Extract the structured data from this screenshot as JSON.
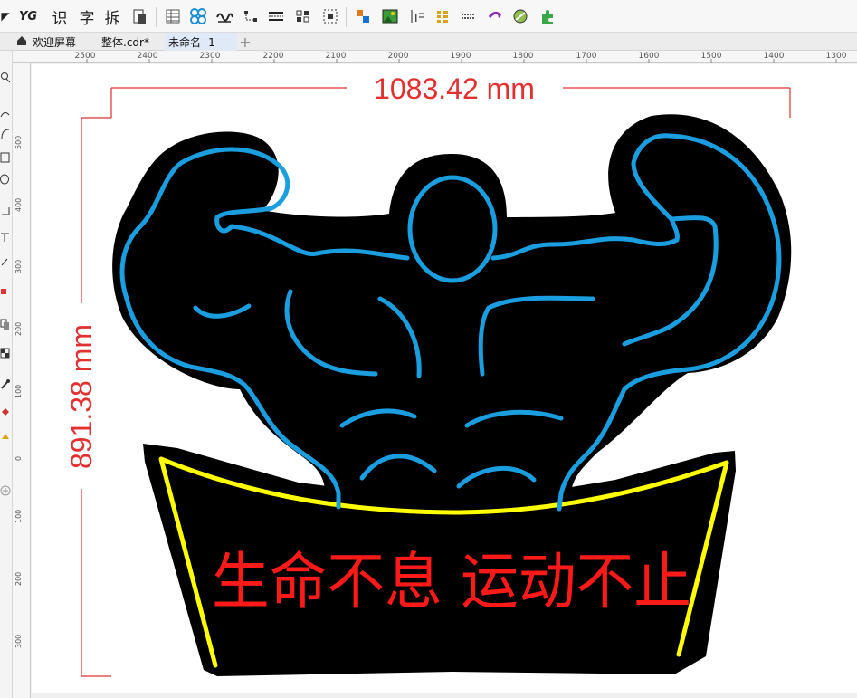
{
  "toolbar": {
    "items": [
      {
        "label": "YG"
      },
      {
        "label": "识"
      },
      {
        "label": "字"
      },
      {
        "label": "拆"
      }
    ]
  },
  "tabs": [
    {
      "label": "欢迎屏幕",
      "active": false
    },
    {
      "label": "整体.cdr*",
      "active": false
    },
    {
      "label": "未命名 -1",
      "active": true
    }
  ],
  "rulers": {
    "horizontal": [
      "2500",
      "2400",
      "2300",
      "2200",
      "2100",
      "2000",
      "1900",
      "1800",
      "1700",
      "1600",
      "1500",
      "1400",
      "1300"
    ],
    "vertical": [
      "500",
      "400",
      "300",
      "200",
      "100",
      "0",
      "100",
      "200",
      "300"
    ]
  },
  "drawing": {
    "width_dimension": "1083.42 mm",
    "height_dimension": "891.38 mm",
    "banner_text": "生命不息 运动不止",
    "colors": {
      "dimension": "#e03030",
      "outline": "#1a9ee0",
      "banner_border": "#ffff00",
      "banner_text": "#ff1a1a",
      "fill": "#000000"
    }
  }
}
